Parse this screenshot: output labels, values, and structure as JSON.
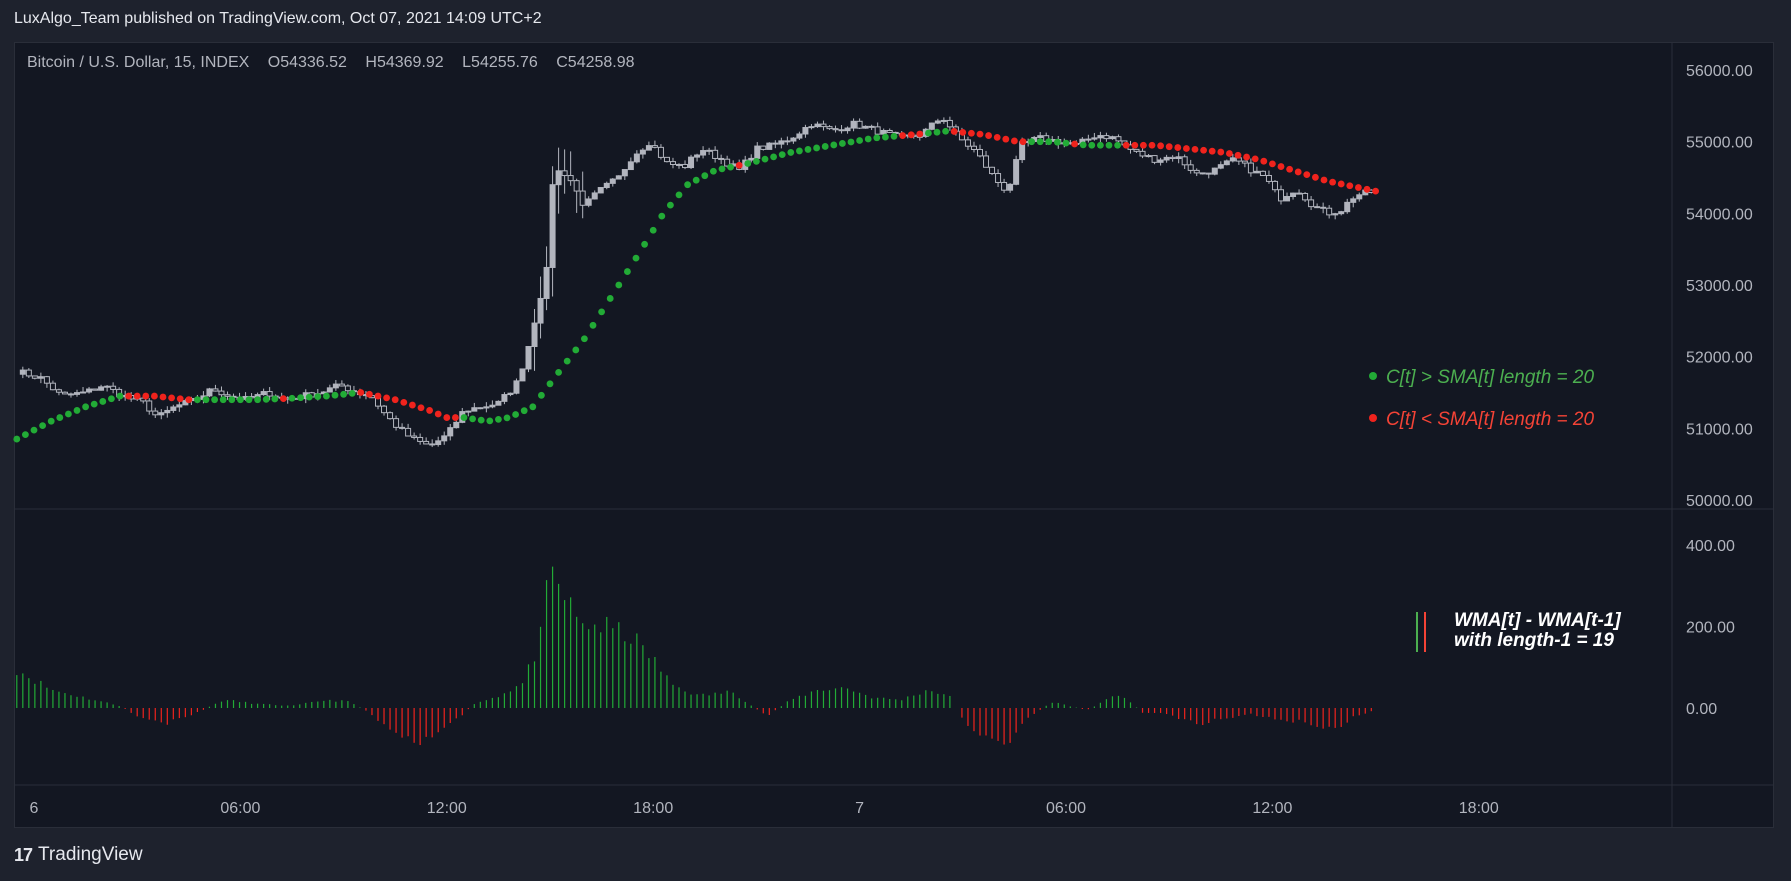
{
  "header": {
    "publisher_line": "LuxAlgo_Team published on TradingView.com, Oct 07, 2021 14:09 UTC+2"
  },
  "symbol": {
    "name": "Bitcoin / U.S. Dollar, 15, INDEX",
    "open": "O54336.52",
    "high": "H54369.92",
    "low": "L54255.76",
    "close": "C54258.98"
  },
  "legend": {
    "above": "C[t] > SMA[t] length = 20",
    "below": "C[t] < SMA[t] length = 20",
    "oscillator_line1": "WMA[t] - WMA[t-1]",
    "oscillator_line2": "with length-1 = 19"
  },
  "footer": {
    "brand": "TradingView",
    "logo": "tradingview-logo-icon"
  },
  "colors": {
    "bullish": "#22ab36",
    "bearish": "#f0231d",
    "candle": "#b2b5be",
    "background": "#131722",
    "page": "#1e222d",
    "grid": "#2a2e39",
    "legend_above": "#4caf50",
    "legend_below": "#f44336"
  },
  "chart_data": [
    {
      "type": "candlestick",
      "title": "Bitcoin / U.S. Dollar, 15, INDEX",
      "y_axis": {
        "ticks": [
          "56000.00",
          "55000.00",
          "54000.00",
          "53000.00",
          "52000.00",
          "51000.00",
          "50000.00"
        ],
        "ylim": [
          50000,
          56000
        ]
      },
      "x_axis": {
        "ticks": [
          "6",
          "06:00",
          "12:00",
          "18:00",
          "7",
          "06:00",
          "12:00",
          "18:00"
        ],
        "tick_hours": [
          0,
          6,
          12,
          18,
          24,
          30,
          36,
          42
        ]
      },
      "candle_interval_minutes": 15,
      "price_points": [
        [
          -0.5,
          51800
        ],
        [
          0.2,
          51700
        ],
        [
          0.8,
          51450
        ],
        [
          1.5,
          51500
        ],
        [
          2.0,
          51600
        ],
        [
          2.6,
          51450
        ],
        [
          3.2,
          51350
        ],
        [
          3.6,
          51150
        ],
        [
          4.1,
          51300
        ],
        [
          4.7,
          51400
        ],
        [
          5.2,
          51550
        ],
        [
          5.7,
          51450
        ],
        [
          6.2,
          51400
        ],
        [
          6.8,
          51500
        ],
        [
          7.3,
          51400
        ],
        [
          7.8,
          51450
        ],
        [
          8.3,
          51500
        ],
        [
          8.9,
          51600
        ],
        [
          9.4,
          51500
        ],
        [
          9.8,
          51450
        ],
        [
          10.2,
          51200
        ],
        [
          10.6,
          51000
        ],
        [
          11.0,
          50850
        ],
        [
          11.5,
          50750
        ],
        [
          12.0,
          50900
        ],
        [
          12.5,
          51250
        ],
        [
          13.0,
          51300
        ],
        [
          13.5,
          51350
        ],
        [
          14.0,
          51600
        ],
        [
          14.3,
          52000
        ],
        [
          14.6,
          52600
        ],
        [
          14.9,
          53200
        ],
        [
          15.1,
          54600
        ],
        [
          15.5,
          54550
        ],
        [
          16.0,
          54100
        ],
        [
          16.4,
          54300
        ],
        [
          17.0,
          54500
        ],
        [
          17.4,
          54800
        ],
        [
          17.9,
          55000
        ],
        [
          18.4,
          54700
        ],
        [
          18.9,
          54650
        ],
        [
          19.4,
          54900
        ],
        [
          20.0,
          54750
        ],
        [
          20.5,
          54600
        ],
        [
          21.0,
          54900
        ],
        [
          21.5,
          54950
        ],
        [
          22.0,
          55050
        ],
        [
          22.6,
          55250
        ],
        [
          23.2,
          55150
        ],
        [
          23.8,
          55250
        ],
        [
          24.5,
          55150
        ],
        [
          25.2,
          55050
        ],
        [
          25.8,
          55100
        ],
        [
          26.4,
          55350
        ],
        [
          26.9,
          55050
        ],
        [
          27.4,
          54850
        ],
        [
          27.9,
          54500
        ],
        [
          28.3,
          54300
        ],
        [
          28.7,
          54950
        ],
        [
          29.2,
          55050
        ],
        [
          29.8,
          55000
        ],
        [
          30.3,
          54950
        ],
        [
          30.9,
          55100
        ],
        [
          31.4,
          55050
        ],
        [
          32.0,
          54850
        ],
        [
          32.6,
          54750
        ],
        [
          33.2,
          54800
        ],
        [
          33.8,
          54550
        ],
        [
          34.3,
          54600
        ],
        [
          34.9,
          54750
        ],
        [
          35.4,
          54600
        ],
        [
          35.8,
          54500
        ],
        [
          36.2,
          54200
        ],
        [
          36.7,
          54350
        ],
        [
          37.2,
          54100
        ],
        [
          37.6,
          54000
        ],
        [
          38.0,
          54050
        ],
        [
          38.4,
          54250
        ],
        [
          38.9,
          54300
        ]
      ],
      "legend": [
        "C[t] > SMA[t] length = 20",
        "C[t] < SMA[t] length = 20"
      ]
    },
    {
      "type": "line",
      "series_kind": "dots",
      "sma_points": [
        [
          -0.5,
          50850
        ],
        [
          0.5,
          51100
        ],
        [
          1.5,
          51300
        ],
        [
          2.5,
          51450
        ],
        [
          3.5,
          51450
        ],
        [
          4.5,
          51400
        ],
        [
          5.5,
          51400
        ],
        [
          6.5,
          51400
        ],
        [
          7.5,
          51420
        ],
        [
          8.5,
          51450
        ],
        [
          9.5,
          51500
        ],
        [
          10.5,
          51400
        ],
        [
          11.5,
          51250
        ],
        [
          12.0,
          51150
        ],
        [
          12.5,
          51150
        ],
        [
          13.2,
          51100
        ],
        [
          13.8,
          51150
        ],
        [
          14.5,
          51300
        ],
        [
          15.2,
          51750
        ],
        [
          16.0,
          52250
        ],
        [
          16.8,
          52850
        ],
        [
          17.6,
          53450
        ],
        [
          18.3,
          54000
        ],
        [
          19.0,
          54400
        ],
        [
          19.8,
          54600
        ],
        [
          20.8,
          54700
        ],
        [
          22.0,
          54850
        ],
        [
          23.2,
          54950
        ],
        [
          24.4,
          55050
        ],
        [
          25.6,
          55100
        ],
        [
          26.6,
          55150
        ],
        [
          27.6,
          55100
        ],
        [
          28.6,
          55000
        ],
        [
          29.6,
          55000
        ],
        [
          30.6,
          54950
        ],
        [
          31.6,
          54950
        ],
        [
          32.6,
          54950
        ],
        [
          33.6,
          54900
        ],
        [
          34.6,
          54850
        ],
        [
          35.6,
          54750
        ],
        [
          36.6,
          54600
        ],
        [
          37.6,
          54450
        ],
        [
          38.6,
          54350
        ],
        [
          39.1,
          54300
        ]
      ],
      "color_rule": "green when close > SMA, red when close < SMA",
      "legend": [
        "C[t] > SMA[t] length = 20",
        "C[t] < SMA[t] length = 20"
      ]
    },
    {
      "type": "bar",
      "title": "WMA[t] - WMA[t-1] with length-1 = 19",
      "y_axis": {
        "ticks": [
          "400.00",
          "200.00",
          "0.00"
        ],
        "ylim": [
          -190,
          415
        ]
      },
      "value_points": [
        [
          -0.5,
          95
        ],
        [
          0.5,
          45
        ],
        [
          1.5,
          25
        ],
        [
          2.5,
          5
        ],
        [
          3.0,
          -20
        ],
        [
          3.8,
          -40
        ],
        [
          4.8,
          -10
        ],
        [
          5.5,
          20
        ],
        [
          6.5,
          10
        ],
        [
          7.5,
          5
        ],
        [
          8.5,
          20
        ],
        [
          9.2,
          15
        ],
        [
          9.8,
          -15
        ],
        [
          10.5,
          -60
        ],
        [
          11.2,
          -80
        ],
        [
          12.0,
          -50
        ],
        [
          12.8,
          10
        ],
        [
          13.5,
          30
        ],
        [
          14.2,
          60
        ],
        [
          14.7,
          160
        ],
        [
          15.0,
          330
        ],
        [
          15.4,
          280
        ],
        [
          15.8,
          210
        ],
        [
          16.5,
          200
        ],
        [
          17.3,
          180
        ],
        [
          18.0,
          120
        ],
        [
          18.5,
          60
        ],
        [
          19.3,
          30
        ],
        [
          20.3,
          40
        ],
        [
          21.3,
          -20
        ],
        [
          22.0,
          20
        ],
        [
          22.8,
          45
        ],
        [
          23.6,
          50
        ],
        [
          24.4,
          25
        ],
        [
          25.2,
          20
        ],
        [
          26.0,
          45
        ],
        [
          26.6,
          30
        ],
        [
          27.0,
          -30
        ],
        [
          27.6,
          -70
        ],
        [
          28.2,
          -95
        ],
        [
          28.8,
          -30
        ],
        [
          29.6,
          15
        ],
        [
          30.6,
          -5
        ],
        [
          31.2,
          20
        ],
        [
          31.6,
          35
        ],
        [
          32.2,
          -10
        ],
        [
          33.0,
          -15
        ],
        [
          33.8,
          -40
        ],
        [
          34.6,
          -25
        ],
        [
          35.4,
          -15
        ],
        [
          36.2,
          -30
        ],
        [
          37.0,
          -35
        ],
        [
          37.8,
          -55
        ],
        [
          38.4,
          -20
        ],
        [
          39.0,
          -5
        ]
      ],
      "legend": [
        "WMA[t] - WMA[t-1]",
        "with length-1 = 19"
      ]
    }
  ]
}
